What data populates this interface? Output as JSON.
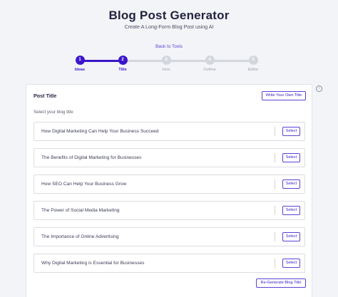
{
  "header": {
    "title": "Blog Post Generator",
    "subtitle": "Create A Long-Form Blog Post using AI",
    "back_link": "Back to Tools"
  },
  "stepper": {
    "steps": [
      {
        "number": "1",
        "label": "Ideas",
        "state": "active"
      },
      {
        "number": "2",
        "label": "Title",
        "state": "active"
      },
      {
        "number": "3",
        "label": "Intro",
        "state": "inactive"
      },
      {
        "number": "4",
        "label": "Outline",
        "state": "inactive"
      },
      {
        "number": "5",
        "label": "Editor",
        "state": "inactive"
      }
    ]
  },
  "info_icon": "i",
  "card": {
    "title": "Post Title",
    "write_button": "Write Your Own Title",
    "prompt": "Select your blog title",
    "select_label": "Select",
    "regenerate_button": "Re-Generate Blog Title",
    "options": [
      "How Digital Marketing Can Help Your Business Succeed",
      "The Benefits of Digital Marketing for Businesses",
      "How SEO Can Help Your Business Grow",
      "The Power of Social Media Marketing",
      "The Importance of Online Advertising",
      "Why Digital Marketing is Essential for Businesses"
    ]
  },
  "colors": {
    "accent": "#3b16c9",
    "inactive_step": "#d4d6dd",
    "background": "#f3f4f7"
  }
}
